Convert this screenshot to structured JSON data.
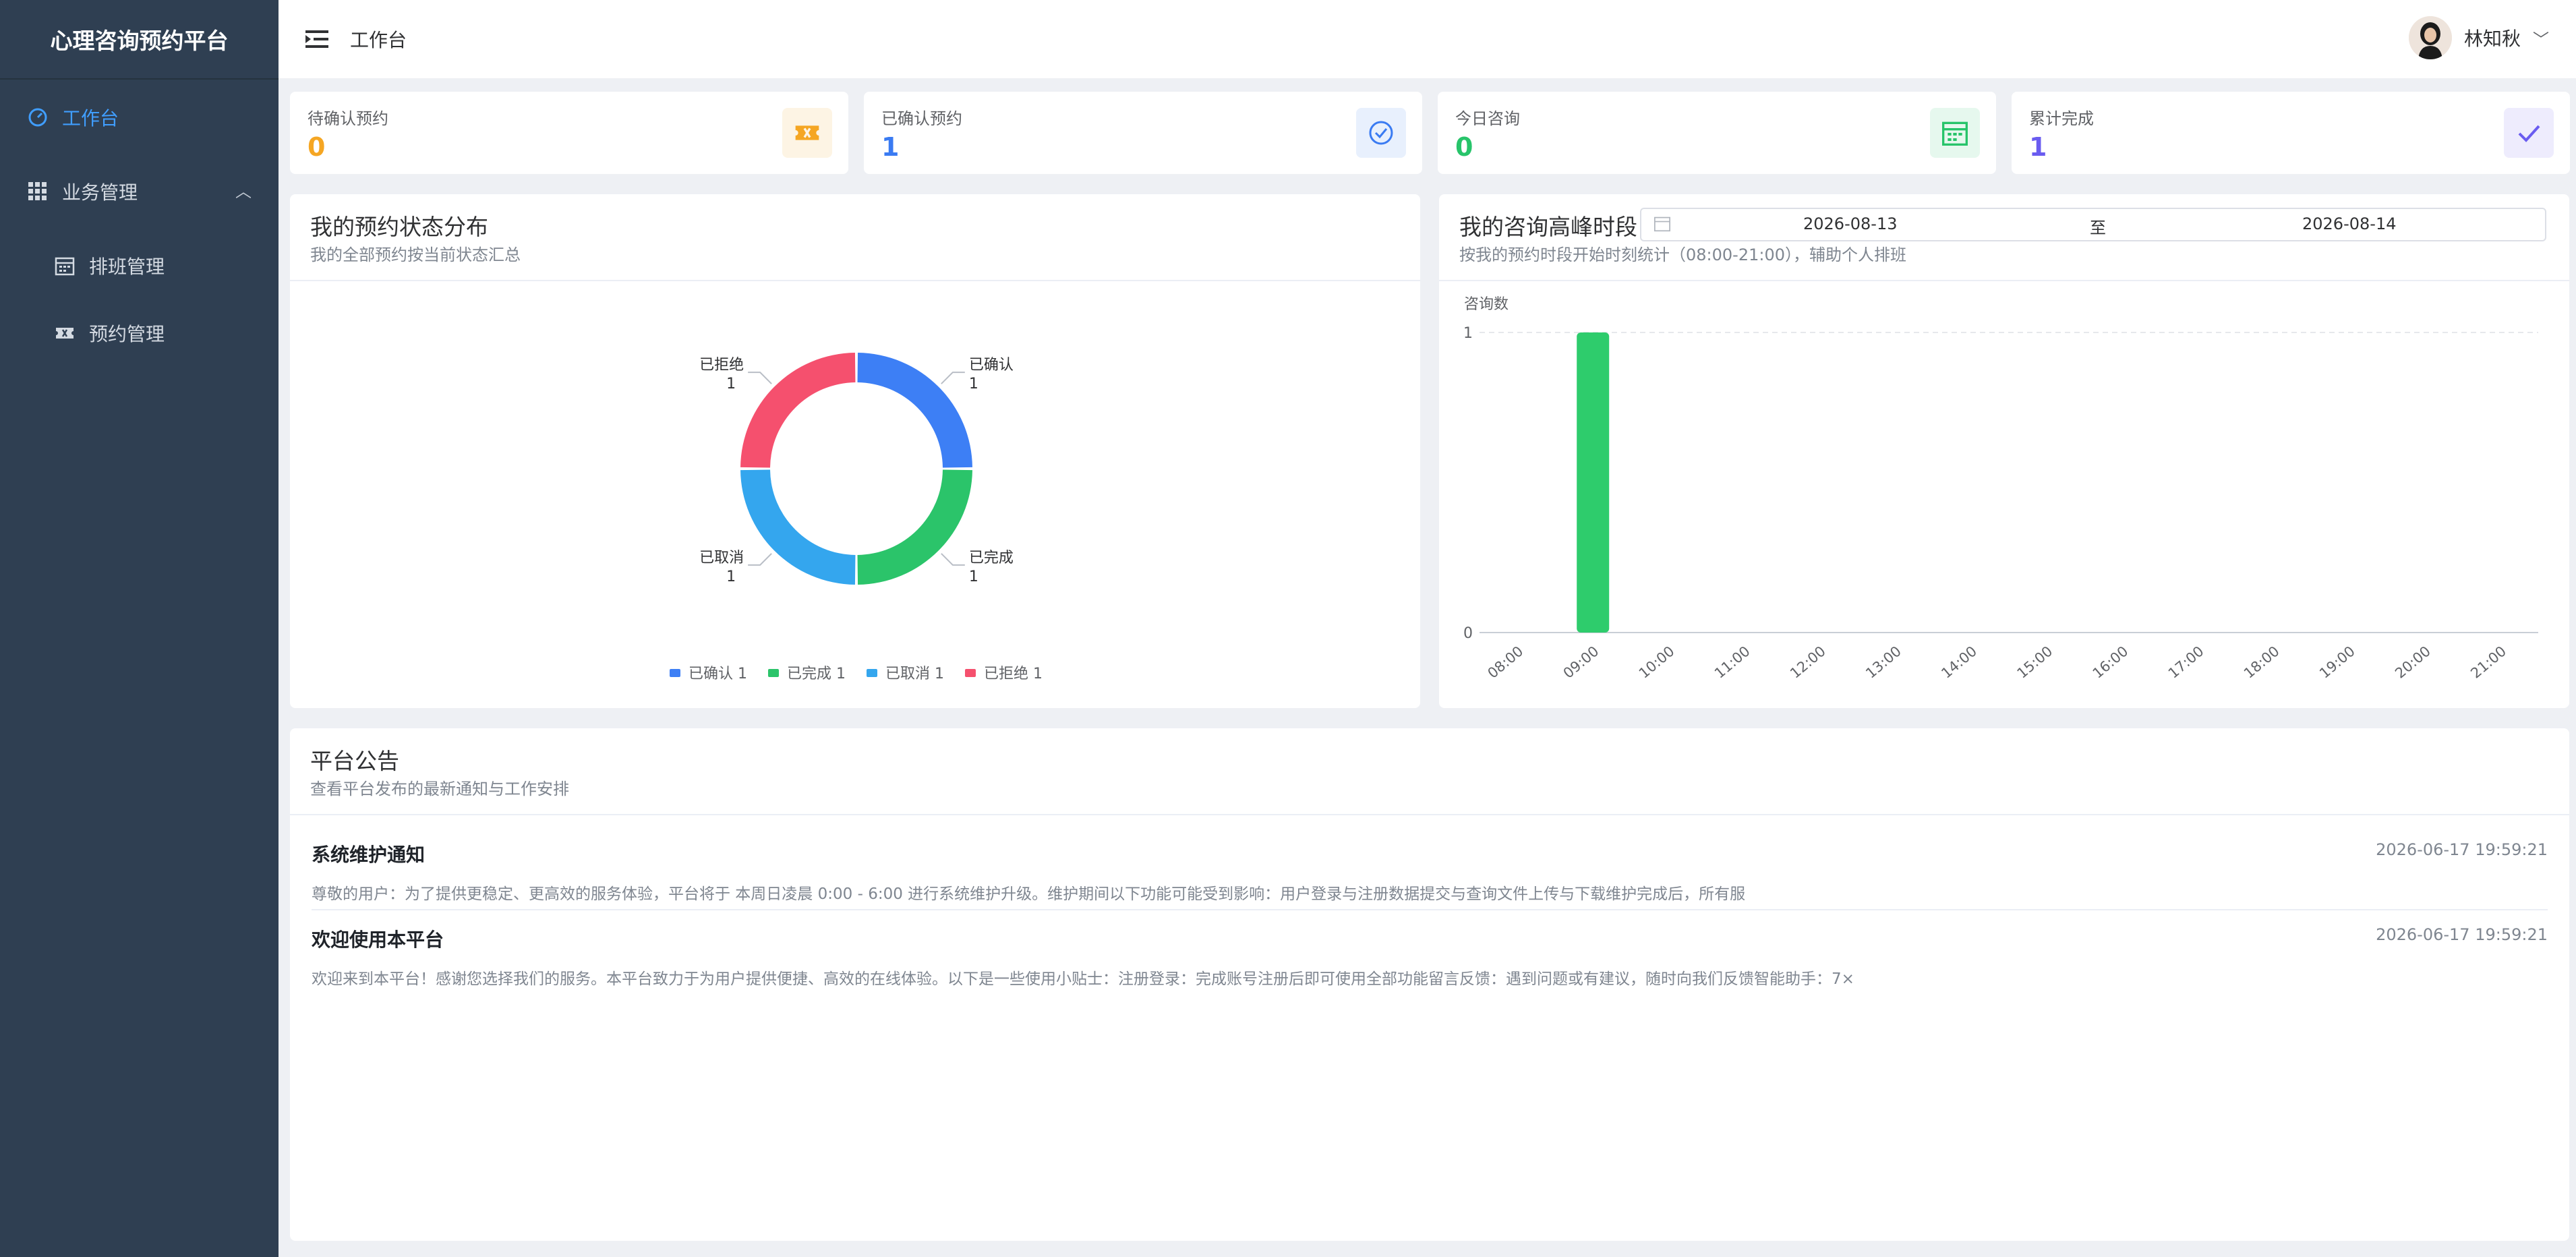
{
  "app_title": "心理咨询预约平台",
  "sidebar": {
    "items": [
      {
        "label": "工作台"
      },
      {
        "label": "业务管理"
      },
      {
        "label": "排班管理"
      },
      {
        "label": "预约管理"
      }
    ]
  },
  "header": {
    "breadcrumb": "工作台",
    "username": "林知秋"
  },
  "stats": [
    {
      "label": "待确认预约",
      "value": "0",
      "color": "#f5a623"
    },
    {
      "label": "已确认预约",
      "value": "1",
      "color": "#3a7bf2"
    },
    {
      "label": "今日咨询",
      "value": "0",
      "color": "#27c46a"
    },
    {
      "label": "累计完成",
      "value": "1",
      "color": "#6a5cf0"
    }
  ],
  "status_panel": {
    "title": "我的预约状态分布",
    "subtitle": "我的全部预约按当前状态汇总"
  },
  "peak_panel": {
    "title": "我的咨询高峰时段",
    "subtitle": "按我的预约时段开始时刻统计（08:00-21:00），辅助个人排班",
    "date_start": "2026-08-13",
    "date_sep": "至",
    "date_end": "2026-08-14"
  },
  "chart_data": [
    {
      "type": "pie",
      "categories": [
        "已确认",
        "已完成",
        "已取消",
        "已拒绝"
      ],
      "values": [
        1,
        1,
        1,
        1
      ],
      "colors": [
        "#3d7ff5",
        "#2bc46a",
        "#34a6ee",
        "#f5506e"
      ],
      "donut": true,
      "legend": "bottom"
    },
    {
      "type": "bar",
      "ylabel": "咨询数",
      "categories": [
        "08:00",
        "09:00",
        "10:00",
        "11:00",
        "12:00",
        "13:00",
        "14:00",
        "15:00",
        "16:00",
        "17:00",
        "18:00",
        "19:00",
        "20:00",
        "21:00"
      ],
      "values": [
        0,
        1,
        0,
        0,
        0,
        0,
        0,
        0,
        0,
        0,
        0,
        0,
        0,
        0
      ],
      "yticks": [
        "0",
        "1"
      ],
      "ylim": [
        0,
        1
      ],
      "color": "#2ecc6c"
    }
  ],
  "announcements": {
    "title": "平台公告",
    "subtitle": "查看平台发布的最新通知与工作安排",
    "items": [
      {
        "title": "系统维护通知",
        "time": "2026-06-17 19:59:21",
        "body": "尊敬的用户：为了提供更稳定、更高效的服务体验，平台将于 本周日凌晨 0:00 - 6:00 进行系统维护升级。维护期间以下功能可能受到影响：用户登录与注册数据提交与查询文件上传与下载维护完成后，所有服"
      },
      {
        "title": "欢迎使用本平台",
        "time": "2026-06-17 19:59:21",
        "body": "欢迎来到本平台！感谢您选择我们的服务。本平台致力于为用户提供便捷、高效的在线体验。以下是一些使用小贴士：注册登录：完成账号注册后即可使用全部功能留言反馈：遇到问题或有建议，随时向我们反馈智能助手：7×"
      }
    ]
  }
}
